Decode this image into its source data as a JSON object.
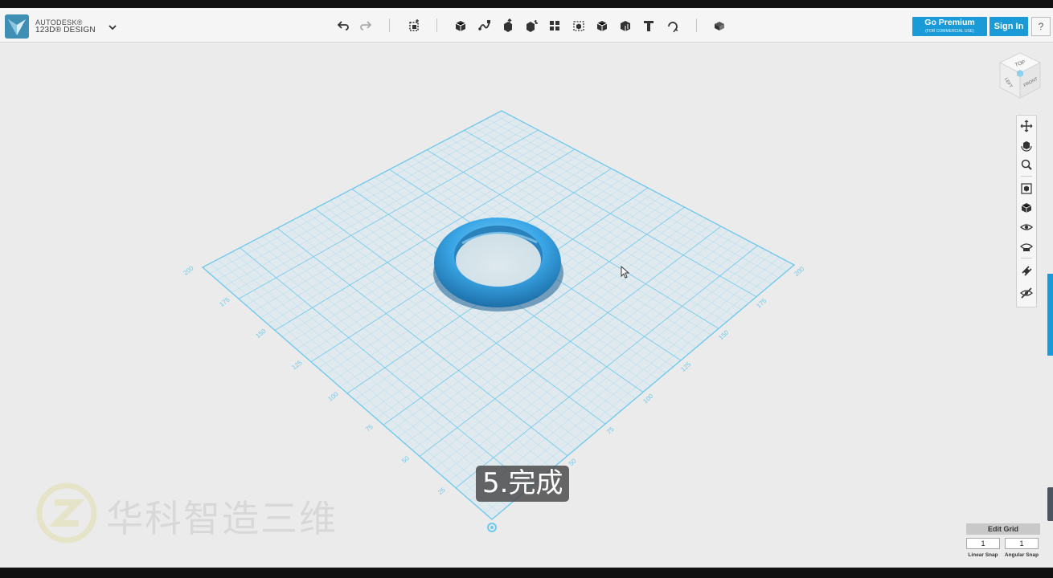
{
  "app": {
    "brand_line1": "AUTODESK®",
    "brand_line2": "123D® DESIGN"
  },
  "toolbar": {
    "tools": [
      "undo-icon",
      "redo-icon",
      "transform-icon",
      "primitives-icon",
      "sketch-icon",
      "construct-icon",
      "modify-icon",
      "pattern-icon",
      "grouping-icon",
      "combine-icon",
      "measure-icon",
      "text-icon",
      "snap-icon",
      "material-icon"
    ]
  },
  "header_buttons": {
    "premium_label": "Go Premium",
    "premium_sub": "(FOR COMMERCIAL USE)",
    "signin_label": "Sign In",
    "help_label": "?"
  },
  "viewcube": {
    "top": "TOP",
    "left": "LEFT",
    "front": "FRONT"
  },
  "navbar": {
    "tools": [
      "pan-icon",
      "orbit-icon",
      "zoom-icon",
      "fit-icon",
      "views-icon",
      "visibility-icon",
      "material-display-icon",
      "snap-tool-icon",
      "hide-icon"
    ]
  },
  "grid": {
    "left_axis": [
      "25",
      "50",
      "75",
      "100",
      "125",
      "150",
      "175",
      "200"
    ],
    "right_axis": [
      "50",
      "75",
      "100",
      "125",
      "150",
      "175",
      "200"
    ],
    "line_color": "#6ec8ec",
    "fill_color": "#dde9ee"
  },
  "object": {
    "type": "torus",
    "color": "#3aa6e6"
  },
  "caption": {
    "text": "5.完成"
  },
  "watermark": {
    "text": "华科智造三维"
  },
  "grid_panel": {
    "edit_label": "Edit Grid",
    "linear_value": "1",
    "angular_value": "1",
    "linear_label": "Linear Snap",
    "angular_label": "Angular Snap"
  }
}
